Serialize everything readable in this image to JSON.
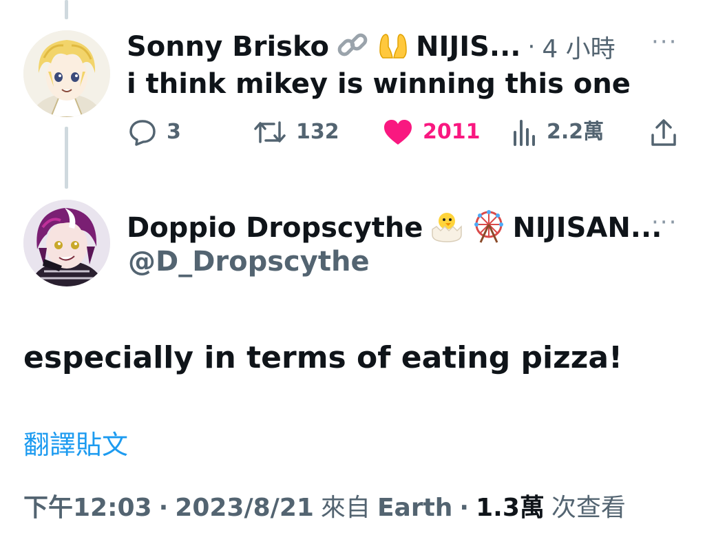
{
  "reply_parent": {
    "display_name": "Sonny Brisko",
    "name_suffix": "NIJIS...",
    "separator": "·",
    "time_ago": "4 小時",
    "more": "···",
    "text": "i think mikey is winning this one",
    "actions": {
      "replies": "3",
      "retweets": "132",
      "likes": "2011",
      "views": "2.2萬"
    },
    "like_color": "#f91880"
  },
  "main_tweet": {
    "display_name": "Doppio Dropscythe",
    "name_suffix": "NIJISAN...",
    "handle": "@D_Dropscythe",
    "more": "···",
    "text": "especially in terms of eating pizza!",
    "translate_label": "翻譯貼文",
    "translate_color": "#1d9bf0",
    "time": "下午12:03",
    "sep1": "·",
    "date": "2023/8/21",
    "source_prefix": "來自",
    "source": "Earth",
    "sep2": "·",
    "view_count": "1.3萬",
    "view_label": "次查看"
  },
  "icons": [
    "link-icon",
    "raising-hands-icon",
    "reply-icon",
    "retweet-icon",
    "heart-icon",
    "views-icon",
    "share-icon",
    "hatching-chick-icon",
    "ferris-wheel-icon",
    "more-icon"
  ]
}
